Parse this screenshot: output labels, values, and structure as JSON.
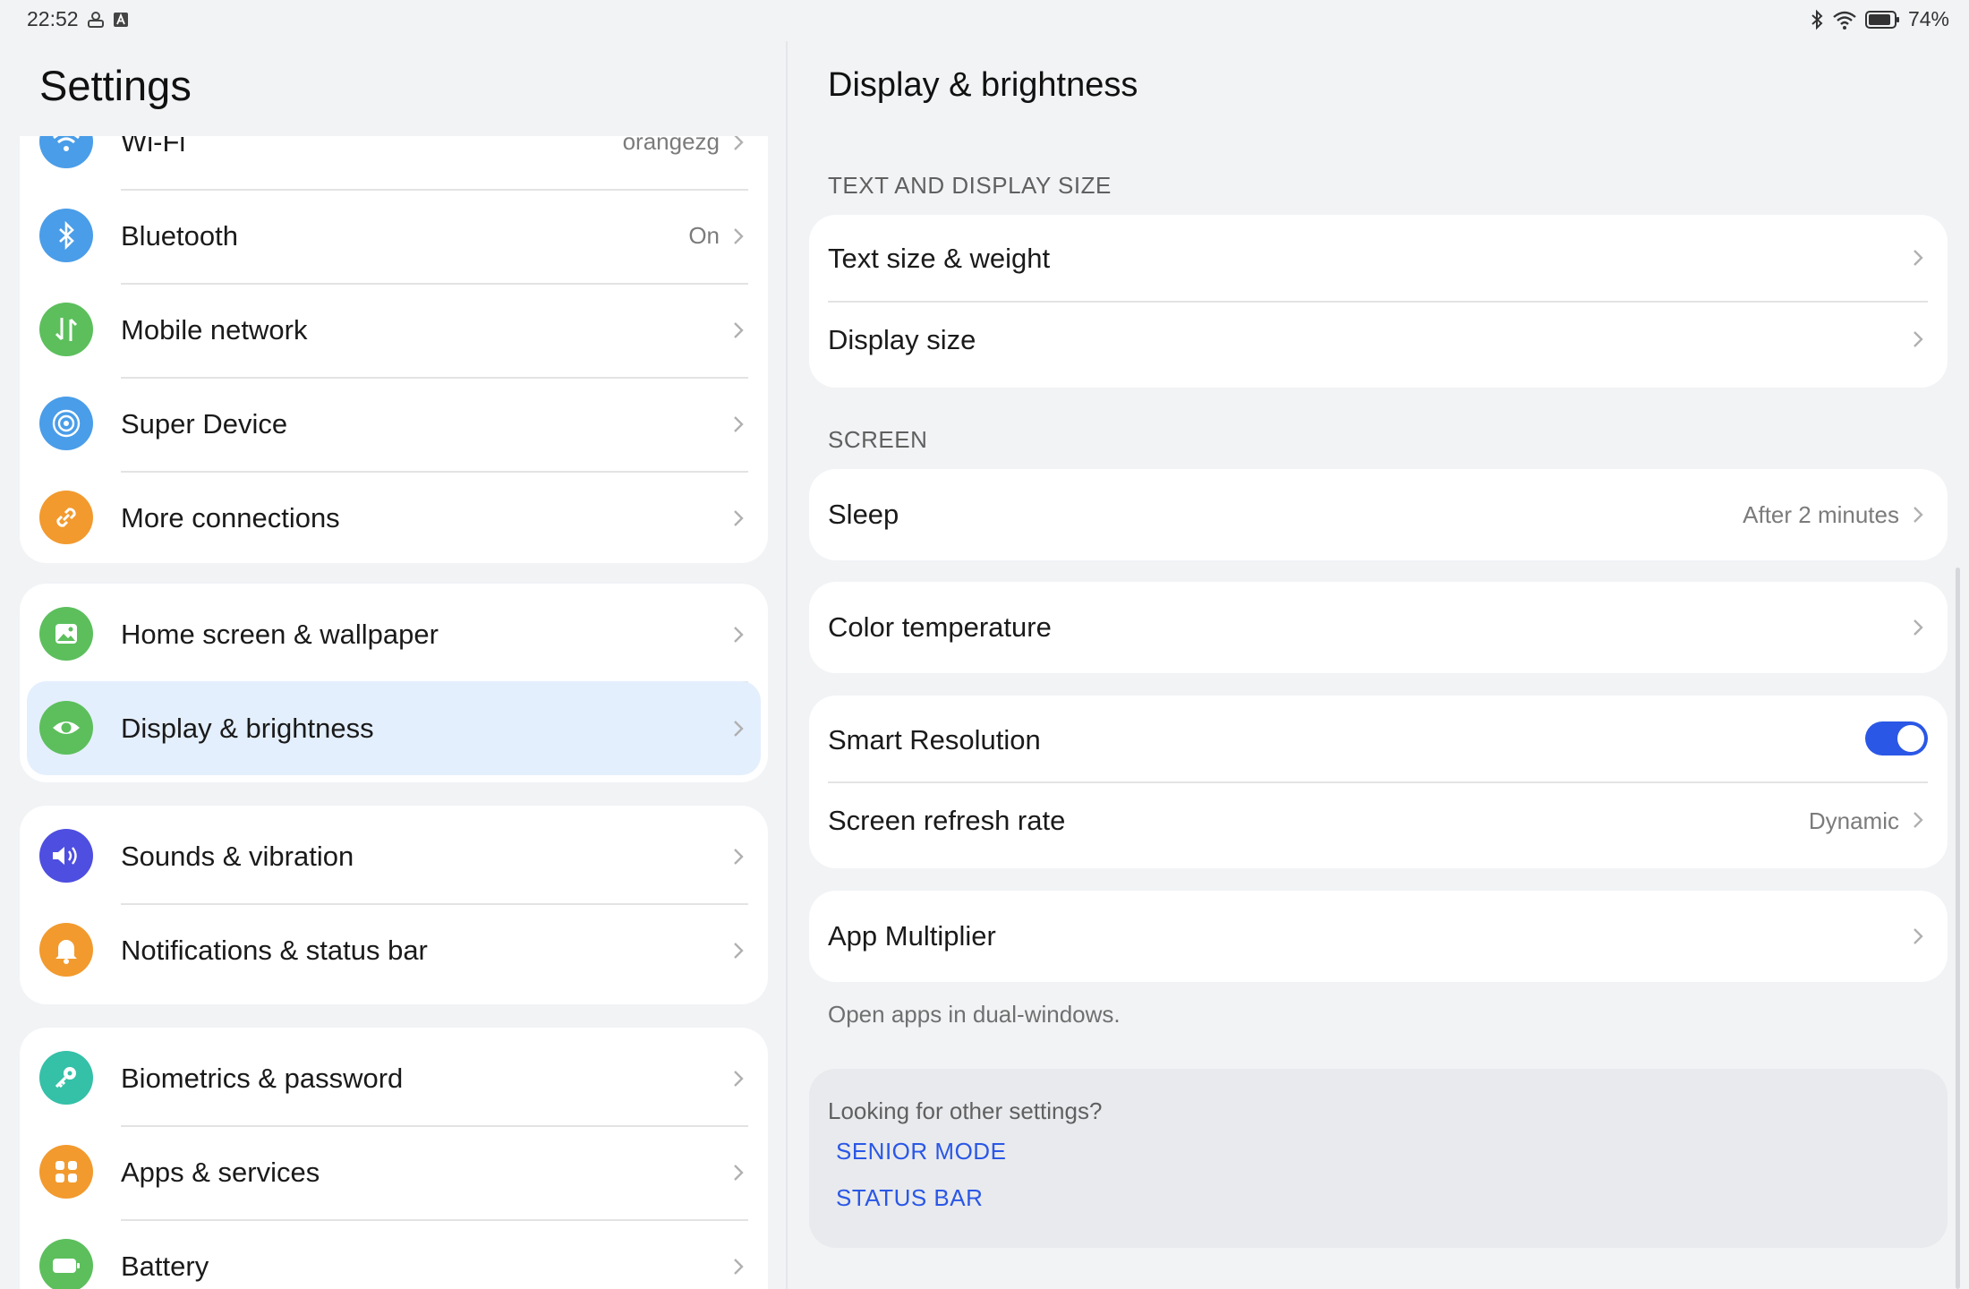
{
  "status_bar": {
    "time": "22:52",
    "battery_percent": "74%",
    "icons_left": [
      "notification-icon",
      "a-badge-icon"
    ],
    "icons_right": [
      "bluetooth-icon",
      "wifi-icon",
      "battery-icon"
    ]
  },
  "left": {
    "title": "Settings",
    "groups": [
      {
        "items": [
          {
            "label": "Wi-Fi",
            "value": "orangezg",
            "icon": "wifi-icon",
            "color": "#4a9de8"
          },
          {
            "label": "Bluetooth",
            "value": "On",
            "icon": "bluetooth-icon",
            "color": "#4a9de8"
          },
          {
            "label": "Mobile network",
            "value": "",
            "icon": "mobile-data-icon",
            "color": "#5cbf5c"
          },
          {
            "label": "Super Device",
            "value": "",
            "icon": "super-device-icon",
            "color": "#4a9de8"
          },
          {
            "label": "More connections",
            "value": "",
            "icon": "link-icon",
            "color": "#f29a2e"
          }
        ]
      },
      {
        "items": [
          {
            "label": "Home screen & wallpaper",
            "value": "",
            "icon": "image-icon",
            "color": "#5cbf5c"
          },
          {
            "label": "Display & brightness",
            "value": "",
            "icon": "eye-icon",
            "color": "#5cbf5c",
            "active": true
          }
        ]
      },
      {
        "items": [
          {
            "label": "Sounds & vibration",
            "value": "",
            "icon": "speaker-icon",
            "color": "#4e4ee0"
          },
          {
            "label": "Notifications & status bar",
            "value": "",
            "icon": "bell-icon",
            "color": "#f29a2e"
          }
        ]
      },
      {
        "items": [
          {
            "label": "Biometrics & password",
            "value": "",
            "icon": "key-icon",
            "color": "#35c0a8"
          },
          {
            "label": "Apps & services",
            "value": "",
            "icon": "apps-grid-icon",
            "color": "#f29a2e"
          },
          {
            "label": "Battery",
            "value": "",
            "icon": "battery-icon",
            "color": "#5cbf5c"
          }
        ]
      }
    ]
  },
  "right": {
    "title": "Display & brightness",
    "sections": {
      "text_display_size": "TEXT AND DISPLAY SIZE",
      "screen": "SCREEN"
    },
    "text_size_weight": "Text size & weight",
    "display_size": "Display size",
    "sleep": {
      "label": "Sleep",
      "value": "After 2 minutes"
    },
    "color_temperature": "Color temperature",
    "smart_resolution": {
      "label": "Smart Resolution",
      "on": true
    },
    "refresh_rate": {
      "label": "Screen refresh rate",
      "value": "Dynamic"
    },
    "app_multiplier": {
      "label": "App Multiplier",
      "caption": "Open apps in dual-windows."
    },
    "other": {
      "question": "Looking for other settings?",
      "links": [
        "SENIOR MODE",
        "STATUS BAR"
      ]
    },
    "accent_color": "#2a57e6"
  }
}
